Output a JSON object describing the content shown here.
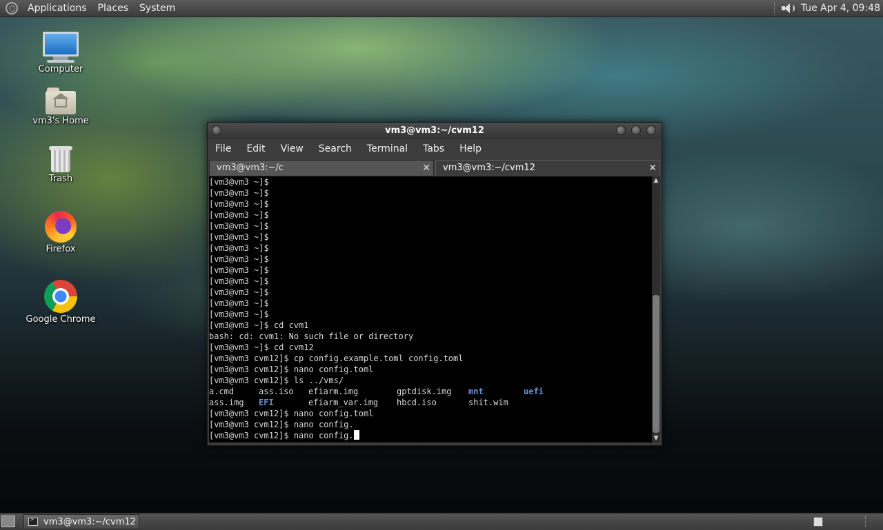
{
  "top_panel": {
    "menus": [
      "Applications",
      "Places",
      "System"
    ],
    "clock": "Tue Apr  4, 09:48"
  },
  "desktop_icons": [
    {
      "label": "Computer",
      "icon": "computer-icon"
    },
    {
      "label": "vm3's Home",
      "icon": "home-folder-icon"
    },
    {
      "label": "Trash",
      "icon": "trash-icon"
    },
    {
      "label": "Firefox",
      "icon": "firefox-icon"
    },
    {
      "label": "Google Chrome",
      "icon": "chrome-icon"
    }
  ],
  "terminal": {
    "title": "vm3@vm3:~/cvm12",
    "menu": [
      "File",
      "Edit",
      "View",
      "Search",
      "Terminal",
      "Tabs",
      "Help"
    ],
    "tabs": [
      {
        "label": "vm3@vm3:~/c",
        "active": false
      },
      {
        "label": "vm3@vm3:~/cvm12",
        "active": true
      }
    ],
    "lines": [
      "[vm3@vm3 ~]$",
      "[vm3@vm3 ~]$",
      "[vm3@vm3 ~]$",
      "[vm3@vm3 ~]$",
      "[vm3@vm3 ~]$",
      "[vm3@vm3 ~]$",
      "[vm3@vm3 ~]$",
      "[vm3@vm3 ~]$",
      "[vm3@vm3 ~]$",
      "[vm3@vm3 ~]$",
      "[vm3@vm3 ~]$",
      "[vm3@vm3 ~]$",
      "[vm3@vm3 ~]$",
      "[vm3@vm3 ~]$ cd cvm1",
      "bash: cd: cvm1: No such file or directory",
      "[vm3@vm3 ~]$ cd cvm12",
      "[vm3@vm3 cvm12]$ cp config.example.toml config.toml",
      "[vm3@vm3 cvm12]$ nano config.toml",
      "[vm3@vm3 cvm12]$ ls ../vms/"
    ],
    "ls_output": [
      [
        {
          "text": "a.cmd",
          "dir": false
        },
        {
          "text": "ass.iso",
          "dir": false
        },
        {
          "text": "efiarm.img",
          "dir": false
        },
        {
          "text": "gptdisk.img",
          "dir": false
        },
        {
          "text": "mnt",
          "dir": true
        },
        {
          "text": "uefi",
          "dir": true
        }
      ],
      [
        {
          "text": "ass.img",
          "dir": false
        },
        {
          "text": "EFI",
          "dir": true
        },
        {
          "text": "efiarm_var.img",
          "dir": false
        },
        {
          "text": "hbcd.iso",
          "dir": false
        },
        {
          "text": "shit.wim",
          "dir": false
        },
        {
          "text": "",
          "dir": false
        }
      ]
    ],
    "after_lines": [
      "[vm3@vm3 cvm12]$ nano config.toml",
      "[vm3@vm3 cvm12]$ nano config."
    ],
    "current_line": "[vm3@vm3 cvm12]$ nano config."
  },
  "bottom_panel": {
    "task_label": "vm3@vm3:~/cvm12"
  }
}
